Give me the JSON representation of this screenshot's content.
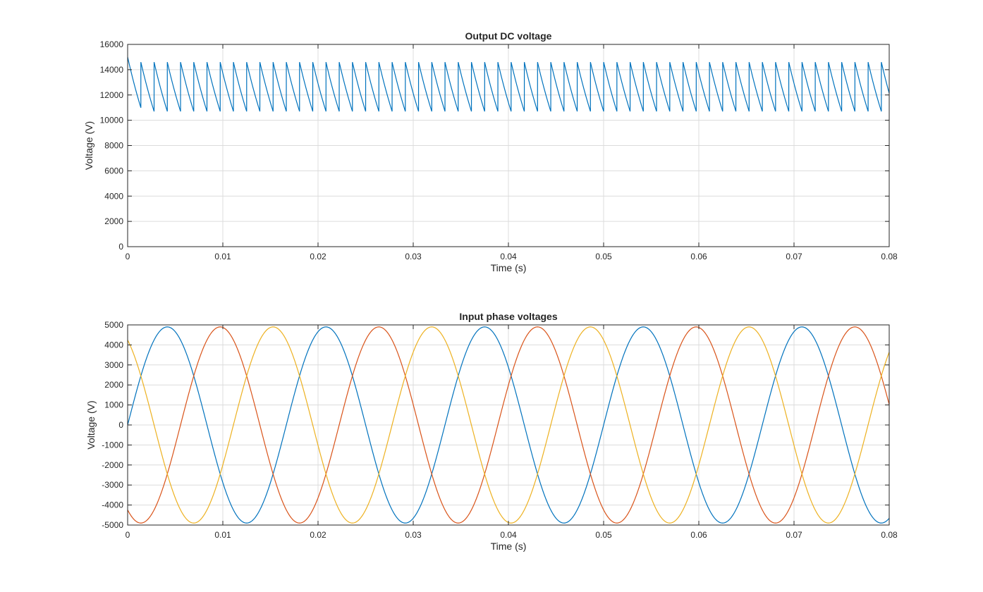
{
  "colors": {
    "background": "#ffffff",
    "axes_box": "#262626",
    "grid": "#dcdcdc",
    "series_1": "#0072BD",
    "series_2": "#D95319",
    "series_3": "#EDB120"
  },
  "chart_data": [
    {
      "type": "line",
      "title": "Output DC voltage",
      "xlabel": "Time (s)",
      "ylabel": "Voltage (V)",
      "xlim": [
        0,
        0.08
      ],
      "ylim": [
        0,
        16000
      ],
      "xticks": [
        0,
        0.01,
        0.02,
        0.03,
        0.04,
        0.05,
        0.06,
        0.07,
        0.08
      ],
      "xtick_labels": [
        "0",
        "0.01",
        "0.02",
        "0.03",
        "0.04",
        "0.05",
        "0.06",
        "0.07",
        "0.08"
      ],
      "yticks": [
        0,
        2000,
        4000,
        6000,
        8000,
        10000,
        12000,
        14000,
        16000
      ],
      "ytick_labels": [
        "0",
        "2000",
        "4000",
        "6000",
        "8000",
        "10000",
        "12000",
        "14000",
        "16000"
      ],
      "grid": true,
      "legend": "none",
      "series": [
        {
          "color": "#0072BD",
          "waveform": "sawtooth-ripple",
          "initial_value": 15000,
          "first_peak_time": 0.00139,
          "ripple_period": 0.001389,
          "peak_value": 14600,
          "trough_value": 10700,
          "end_value": 12900
        }
      ]
    },
    {
      "type": "line",
      "title": "Input phase voltages",
      "xlabel": "Time (s)",
      "ylabel": "Voltage (V)",
      "xlim": [
        0,
        0.08
      ],
      "ylim": [
        -5000,
        5000
      ],
      "xticks": [
        0,
        0.01,
        0.02,
        0.03,
        0.04,
        0.05,
        0.06,
        0.07,
        0.08
      ],
      "xtick_labels": [
        "0",
        "0.01",
        "0.02",
        "0.03",
        "0.04",
        "0.05",
        "0.06",
        "0.07",
        "0.08"
      ],
      "yticks": [
        -5000,
        -4000,
        -3000,
        -2000,
        -1000,
        0,
        1000,
        2000,
        3000,
        4000,
        5000
      ],
      "ytick_labels": [
        "-5000",
        "-4000",
        "-3000",
        "-2000",
        "-1000",
        "0",
        "1000",
        "2000",
        "3000",
        "4000",
        "5000"
      ],
      "grid": true,
      "legend": "none",
      "series": [
        {
          "color": "#0072BD",
          "waveform": "sine",
          "amplitude": 4900,
          "frequency_hz": 60,
          "phase_deg": 0
        },
        {
          "color": "#D95319",
          "waveform": "sine",
          "amplitude": 4900,
          "frequency_hz": 60,
          "phase_deg": -120
        },
        {
          "color": "#EDB120",
          "waveform": "sine",
          "amplitude": 4900,
          "frequency_hz": 60,
          "phase_deg": 120
        }
      ]
    }
  ]
}
